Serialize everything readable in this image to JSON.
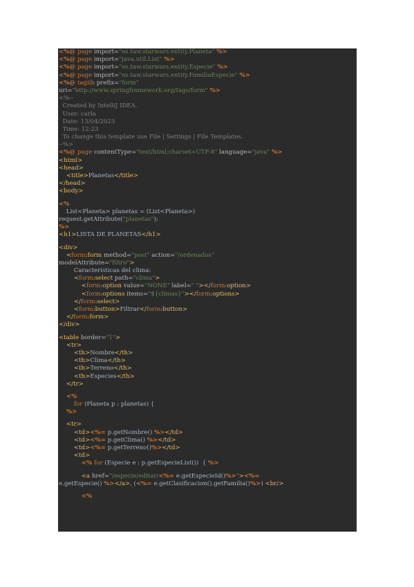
{
  "page": {
    "title": "LISTA DE PLANETAS"
  },
  "code_lines": [
    [
      [
        "dir",
        "<%@ "
      ],
      [
        "kw",
        "page "
      ],
      [
        "attr",
        "import="
      ],
      [
        "str",
        "\"es.taw.starwars.entity.Planeta\""
      ],
      [
        "dir",
        " %>"
      ]
    ],
    [
      [
        "dir",
        "<%@ "
      ],
      [
        "kw",
        "page "
      ],
      [
        "attr",
        "import="
      ],
      [
        "str",
        "\"java.util.List\""
      ],
      [
        "dir",
        " %>"
      ]
    ],
    [
      [
        "dir",
        "<%@ "
      ],
      [
        "kw",
        "page "
      ],
      [
        "attr",
        "import="
      ],
      [
        "str",
        "\"es.taw.starwars.entity.Especie\""
      ],
      [
        "dir",
        " %>"
      ]
    ],
    [
      [
        "dir",
        "<%@ "
      ],
      [
        "kw",
        "page "
      ],
      [
        "attr",
        "import="
      ],
      [
        "str",
        "\"es.taw.starwars.entity.FamiliaEspecie\""
      ],
      [
        "dir",
        " %>"
      ]
    ],
    [
      [
        "dir",
        "<%@ "
      ],
      [
        "kw",
        "taglib "
      ],
      [
        "attr",
        "prefix="
      ],
      [
        "str",
        "\"form\""
      ]
    ],
    [
      [
        "attr",
        "uri="
      ],
      [
        "str",
        "\"http://www.springframework.org/tags/form\""
      ],
      [
        "dir",
        " %>"
      ]
    ],
    [
      [
        "cmt",
        "<%--"
      ]
    ],
    [
      [
        "cmt",
        "  Created by IntelliJ IDEA."
      ]
    ],
    [
      [
        "cmt",
        "  User: carla"
      ]
    ],
    [
      [
        "cmt",
        "  Date: 13/04/2023"
      ]
    ],
    [
      [
        "cmt",
        "  Time: 12:23"
      ]
    ],
    [
      [
        "cmt",
        "  To change this template use File | Settings | File Templates."
      ]
    ],
    [
      [
        "cmt",
        "--%>"
      ]
    ],
    [
      [
        "dir",
        "<%@ "
      ],
      [
        "kw",
        "page "
      ],
      [
        "attr",
        "contentType="
      ],
      [
        "str",
        "\"text/html;charset=UTF-8\""
      ],
      [
        "attr",
        " language="
      ],
      [
        "str",
        "\"java\""
      ],
      [
        "dir",
        " %>"
      ]
    ],
    [
      [
        "tag",
        "<html>"
      ]
    ],
    [
      [
        "tag",
        "<head>"
      ]
    ],
    [
      [
        "plain",
        "    "
      ],
      [
        "tag",
        "<title>"
      ],
      [
        "plain",
        "Planetas"
      ],
      [
        "tag",
        "</title>"
      ]
    ],
    [
      [
        "tag",
        "</head>"
      ]
    ],
    [
      [
        "tag",
        "<body>"
      ]
    ],
    "gap",
    [
      [
        "dir",
        "<%"
      ]
    ],
    [
      [
        "plain",
        "    List<Planeta> planetas = (List<Planeta>)"
      ]
    ],
    [
      [
        "plain",
        "request.getAttribute("
      ],
      [
        "str",
        "\"planetas\""
      ],
      [
        "plain",
        ");"
      ]
    ],
    [
      [
        "dir",
        "%>"
      ]
    ],
    [
      [
        "tag",
        "<h1>"
      ],
      [
        "plain",
        "LISTA DE PLANETAS"
      ],
      [
        "tag",
        "</h1>"
      ]
    ],
    "gap",
    [
      [
        "tag",
        "<div>"
      ]
    ],
    [
      [
        "plain",
        "    "
      ],
      [
        "tag",
        "<"
      ],
      [
        "ns",
        "form"
      ],
      [
        "tag",
        ":form "
      ],
      [
        "attr",
        "method="
      ],
      [
        "str",
        "\"post\""
      ],
      [
        "attr",
        " action="
      ],
      [
        "str",
        "\"/ordenados\""
      ]
    ],
    [
      [
        "attr",
        "modelAttribute="
      ],
      [
        "str",
        "\"filtro\""
      ],
      [
        "tag",
        ">"
      ]
    ],
    [
      [
        "plain",
        "        Caracteristicas del clima:"
      ]
    ],
    [
      [
        "plain",
        "        "
      ],
      [
        "tag",
        "<"
      ],
      [
        "ns",
        "form"
      ],
      [
        "tag",
        ":select "
      ],
      [
        "attr",
        "path="
      ],
      [
        "str",
        "\"clima\""
      ],
      [
        "tag",
        ">"
      ]
    ],
    [
      [
        "plain",
        "            "
      ],
      [
        "tag",
        "<"
      ],
      [
        "ns",
        "form"
      ],
      [
        "tag",
        ":option "
      ],
      [
        "attr",
        "value="
      ],
      [
        "str",
        "\"NONE\""
      ],
      [
        "attr",
        " label="
      ],
      [
        "str",
        "\" \""
      ],
      [
        "tag",
        "></"
      ],
      [
        "ns",
        "form"
      ],
      [
        "tag",
        ":option>"
      ]
    ],
    [
      [
        "plain",
        "            "
      ],
      [
        "tag",
        "<"
      ],
      [
        "ns",
        "form"
      ],
      [
        "tag",
        ":options "
      ],
      [
        "attr",
        "items="
      ],
      [
        "str",
        "\"${climas}\""
      ],
      [
        "tag",
        "></"
      ],
      [
        "ns",
        "form"
      ],
      [
        "tag",
        ":options>"
      ]
    ],
    [
      [
        "plain",
        "        "
      ],
      [
        "tag",
        "</"
      ],
      [
        "ns",
        "form"
      ],
      [
        "tag",
        ":select>"
      ]
    ],
    [
      [
        "plain",
        "        "
      ],
      [
        "tag",
        "<"
      ],
      [
        "ns",
        "form"
      ],
      [
        "tag",
        ":button>"
      ],
      [
        "plain",
        "Filtrar"
      ],
      [
        "tag",
        "</"
      ],
      [
        "ns",
        "form"
      ],
      [
        "tag",
        ":button>"
      ]
    ],
    [
      [
        "plain",
        "    "
      ],
      [
        "tag",
        "</"
      ],
      [
        "ns",
        "form"
      ],
      [
        "tag",
        ":form>"
      ]
    ],
    [
      [
        "tag",
        "</div>"
      ]
    ],
    "gap",
    [
      [
        "tag",
        "<table "
      ],
      [
        "attr",
        "border="
      ],
      [
        "str",
        "\"1\""
      ],
      [
        "tag",
        ">"
      ]
    ],
    [
      [
        "plain",
        "    "
      ],
      [
        "tag",
        "<tr>"
      ]
    ],
    [
      [
        "plain",
        "        "
      ],
      [
        "tag",
        "<th>"
      ],
      [
        "plain",
        "Nombre"
      ],
      [
        "tag",
        "</th>"
      ]
    ],
    [
      [
        "plain",
        "        "
      ],
      [
        "tag",
        "<th>"
      ],
      [
        "plain",
        "Clima"
      ],
      [
        "tag",
        "</th>"
      ]
    ],
    [
      [
        "plain",
        "        "
      ],
      [
        "tag",
        "<th>"
      ],
      [
        "plain",
        "Terreno"
      ],
      [
        "tag",
        "</th>"
      ]
    ],
    [
      [
        "plain",
        "        "
      ],
      [
        "tag",
        "<th>"
      ],
      [
        "plain",
        "Especies"
      ],
      [
        "tag",
        "</th>"
      ]
    ],
    [
      [
        "plain",
        "    "
      ],
      [
        "tag",
        "</tr>"
      ]
    ],
    "gap",
    [
      [
        "plain",
        "    "
      ],
      [
        "dir",
        "<%"
      ]
    ],
    [
      [
        "plain",
        "        "
      ],
      [
        "kw",
        "for "
      ],
      [
        "plain",
        "(Planeta p : planetas) {"
      ]
    ],
    [
      [
        "plain",
        "    "
      ],
      [
        "dir",
        "%>"
      ]
    ],
    "gap",
    [
      [
        "plain",
        "    "
      ],
      [
        "tag",
        "<tr>"
      ]
    ],
    [
      [
        "plain",
        "        "
      ],
      [
        "tag",
        "<td>"
      ],
      [
        "dir",
        "<%= "
      ],
      [
        "plain",
        "p.getNombre() "
      ],
      [
        "dir",
        "%>"
      ],
      [
        "tag",
        "</td>"
      ]
    ],
    [
      [
        "plain",
        "        "
      ],
      [
        "tag",
        "<td>"
      ],
      [
        "dir",
        "<%= "
      ],
      [
        "plain",
        "p.getClima() "
      ],
      [
        "dir",
        "%>"
      ],
      [
        "tag",
        "</td>"
      ]
    ],
    [
      [
        "plain",
        "        "
      ],
      [
        "tag",
        "<td>"
      ],
      [
        "dir",
        "<%= "
      ],
      [
        "plain",
        "p.getTerreno()"
      ],
      [
        "dir",
        "%>"
      ],
      [
        "tag",
        "</td>"
      ]
    ],
    [
      [
        "plain",
        "        "
      ],
      [
        "tag",
        "<td>"
      ]
    ],
    [
      [
        "plain",
        "            "
      ],
      [
        "dir",
        "<% "
      ],
      [
        "kw",
        "for "
      ],
      [
        "plain",
        "(Especie e : p.getEspecieList())  { "
      ],
      [
        "dir",
        "%>"
      ]
    ],
    "gap",
    [
      [
        "plain",
        "            "
      ],
      [
        "tag",
        "<a "
      ],
      [
        "attr",
        "href="
      ],
      [
        "str",
        "\"/especie/editar/"
      ],
      [
        "dir",
        "<%= "
      ],
      [
        "plain",
        "e.getEspecieId()"
      ],
      [
        "dir",
        "%>"
      ],
      [
        "str",
        "\""
      ],
      [
        "tag",
        ">"
      ],
      [
        "dir",
        "<%="
      ]
    ],
    [
      [
        "plain",
        "e.getEspecie() "
      ],
      [
        "dir",
        "%>"
      ],
      [
        "tag",
        "</a>"
      ],
      [
        "plain",
        ", ("
      ],
      [
        "dir",
        "<%= "
      ],
      [
        "plain",
        "e.getClasificacion().getFamilia()"
      ],
      [
        "dir",
        "%>"
      ],
      [
        "plain",
        ") "
      ],
      [
        "tag",
        "<br/>"
      ]
    ],
    "gap",
    [
      [
        "plain",
        "            "
      ],
      [
        "dir",
        "<%"
      ]
    ]
  ]
}
